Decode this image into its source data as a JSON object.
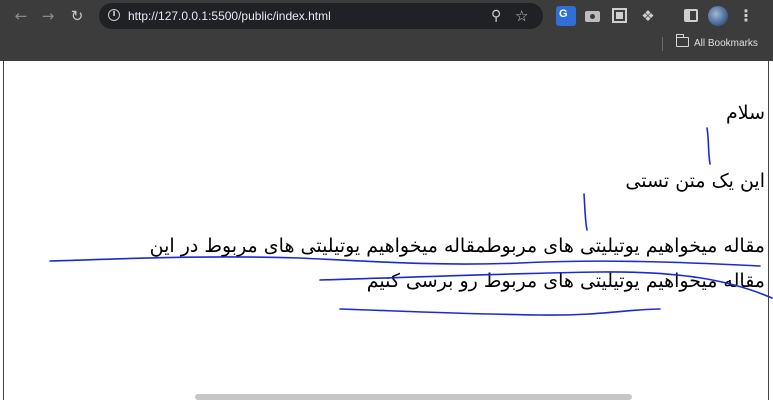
{
  "browser": {
    "url": "http://127.0.0.1:5500/public/index.html",
    "bookmarks_label": "All Bookmarks",
    "icons": [
      "back-icon",
      "forward-icon",
      "reload-icon",
      "site-info-icon",
      "zoom-icon",
      "bookmark-star-icon",
      "translate-extension-icon",
      "camera-extension-icon",
      "qr-extension-icon",
      "extensions-puzzle-icon",
      "side-panel-icon",
      "profile-avatar-icon",
      "menu-icon",
      "folder-icon"
    ]
  },
  "page": {
    "greeting": "سلام",
    "test_text": "این یک متن تستی",
    "paragraph_line_1": "مقاله میخواهیم یوتیلیتی های مربوطمقاله میخواهیم یوتیلیتی های مربوط در این",
    "paragraph_line_2": "مقاله میخواهیم یوتیلیتی های مربوط رو برسی کنیم"
  },
  "annotation": {
    "ink_color": "#1a2bd6"
  }
}
